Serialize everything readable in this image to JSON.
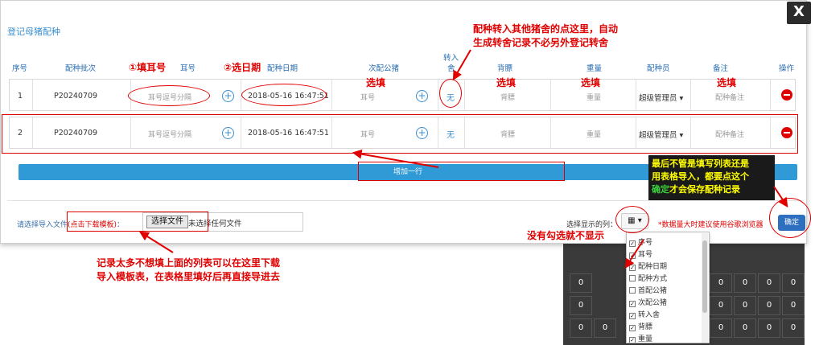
{
  "modal": {
    "title": "登记母猪配种",
    "close": "X"
  },
  "headers": {
    "seq": "序号",
    "batch": "配种批次",
    "ear": "耳号",
    "date": "配种日期",
    "boar": "次配公猪",
    "transfer_1": "转入",
    "transfer_2": "舍",
    "backfat": "背膘",
    "weight": "重量",
    "breeder": "配种员",
    "remark": "备注",
    "action": "操作"
  },
  "rows": [
    {
      "seq": "1",
      "batch": "P20240709",
      "ear_ph": "耳号逗号分隔",
      "date": "2018-05-16 16:47:51",
      "boar_ph": "耳号",
      "transfer": "无",
      "backfat_ph": "背膘",
      "weight_ph": "重量",
      "breeder": "超级管理员",
      "remark_ph": "配种备注"
    },
    {
      "seq": "2",
      "batch": "P20240709",
      "ear_ph": "耳号逗号分隔",
      "date": "2018-05-16 16:47:51",
      "boar_ph": "耳号",
      "transfer": "无",
      "backfat_ph": "背膘",
      "weight_ph": "重量",
      "breeder": "超级管理员",
      "remark_ph": "配种备注"
    }
  ],
  "add_row": "增加一行",
  "import": {
    "label_1": "请选择导入文件",
    "label_link": "(点击下载模板)",
    "label_2": "：",
    "file_button": "选择文件",
    "file_none": "未选择任何文件"
  },
  "columns": {
    "label": "选择显示的列：",
    "button_icon": "grid-icon",
    "items": [
      {
        "label": "序号",
        "checked": true
      },
      {
        "label": "耳号",
        "checked": true
      },
      {
        "label": "配种日期",
        "checked": true
      },
      {
        "label": "配种方式",
        "checked": false
      },
      {
        "label": "首配公猪",
        "checked": false
      },
      {
        "label": "次配公猪",
        "checked": true
      },
      {
        "label": "转入舍",
        "checked": true
      },
      {
        "label": "背膘",
        "checked": true
      },
      {
        "label": "重量",
        "checked": true
      }
    ]
  },
  "warning": "*数据量大时建议使用谷歌浏览器",
  "confirm": "确定",
  "background_cells": [
    "0",
    "0",
    "0",
    "0",
    "0",
    "0",
    "0",
    "0",
    "0",
    "0",
    "0",
    "0",
    "0",
    "0",
    "0",
    "0"
  ],
  "annotations": {
    "fill_ear": "①填耳号",
    "pick_date": "②选日期",
    "transfer_note_1": "配种转入其他猪舍的点这里，自动",
    "transfer_note_2": "生成转舍记录不必另外登记转舍",
    "optional": "选填",
    "tip_1": "最后不管是填写列表还是",
    "tip_2": "用表格导入，都要点这个",
    "tip_3a": "确定",
    "tip_3b": "才会保存配种记录",
    "unchecked_note": "没有勾选就不显示",
    "import_note_1": "记录太多不想填上面的列表可以在这里下载",
    "import_note_2": "导入模板表，在表格里填好后再直接导进去"
  },
  "colors": {
    "accent": "#2f9ad6",
    "annotation": "#e00000",
    "tip_bg": "#1a1a1a",
    "tip_text": "#ffff00",
    "tip_highlight": "#39d239"
  }
}
